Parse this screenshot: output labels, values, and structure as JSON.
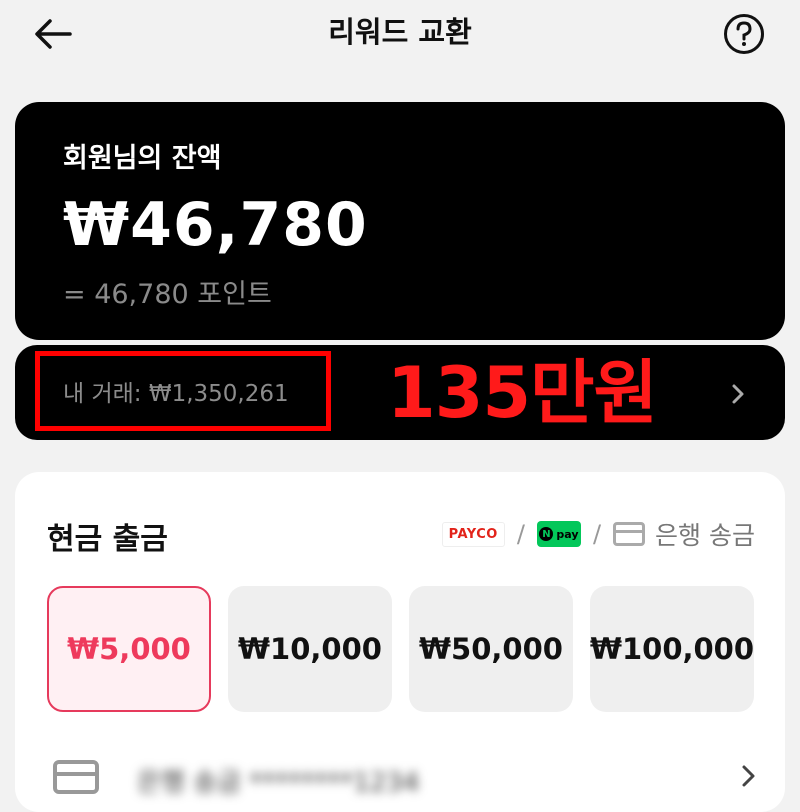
{
  "header": {
    "title": "리워드 교환"
  },
  "balance": {
    "label": "회원님의 잔액",
    "amount": "₩46,780",
    "points": "= 46,780 포인트"
  },
  "transactions": {
    "label": "내 거래: ₩1,350,261",
    "annotation": "135만원"
  },
  "cashout": {
    "title": "현금 출금",
    "methods": {
      "payco": "PAYCO",
      "npay": "pay",
      "separator": "/",
      "bank": "은행 송금"
    },
    "amounts": [
      "₩5,000",
      "₩10,000",
      "₩50,000",
      "₩100,000"
    ],
    "selected_amount": "₩5,000",
    "account_row": "은행 송금 ********1234"
  },
  "colors": {
    "card_bg": "#000000",
    "annotation_red": "#ff0000",
    "selected_pink": "#e63a5c",
    "npay_green": "#03c75a",
    "payco_red": "#e2231a"
  },
  "icons": [
    "back-arrow-icon",
    "help-icon",
    "chevron-right-icon",
    "credit-card-icon"
  ]
}
